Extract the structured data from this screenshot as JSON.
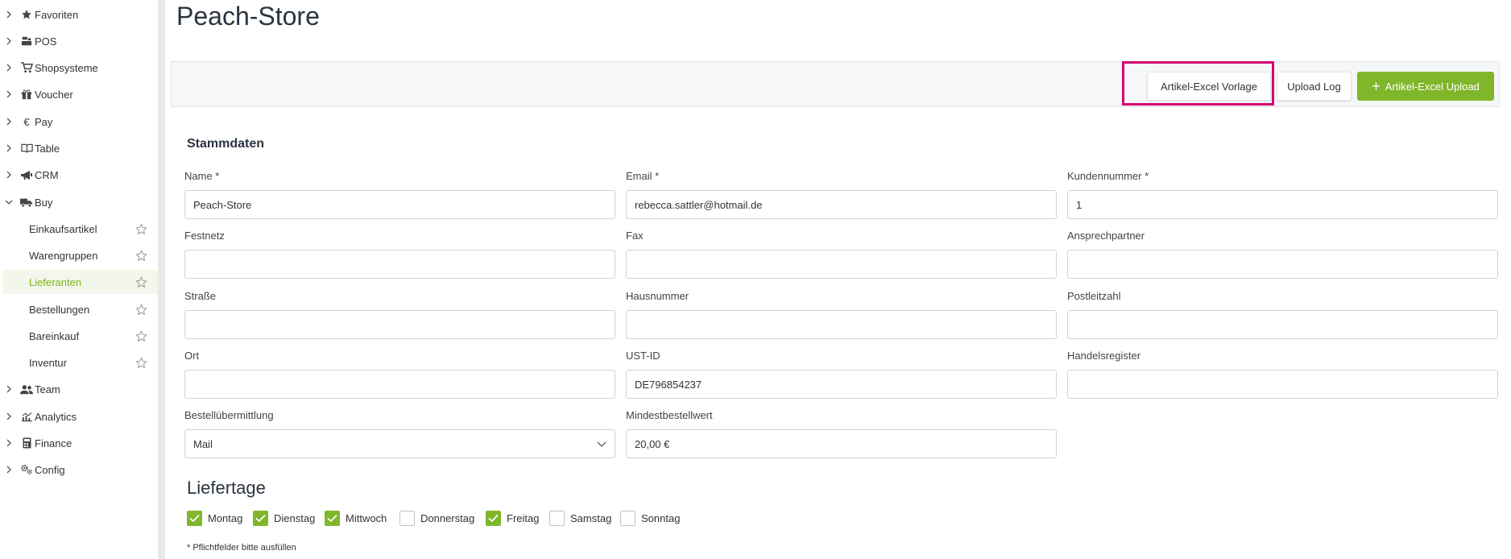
{
  "sidebar": {
    "items": [
      {
        "label": "Favoriten",
        "icon": "star-icon"
      },
      {
        "label": "POS",
        "icon": "register-icon"
      },
      {
        "label": "Shopsysteme",
        "icon": "cart-icon"
      },
      {
        "label": "Voucher",
        "icon": "gift-icon"
      },
      {
        "label": "Pay",
        "icon": "euro-icon"
      },
      {
        "label": "Table",
        "icon": "book-icon"
      },
      {
        "label": "CRM",
        "icon": "megaphone-icon"
      },
      {
        "label": "Buy",
        "icon": "truck-icon"
      }
    ],
    "buy_subitems": [
      {
        "label": "Einkaufsartikel"
      },
      {
        "label": "Warengruppen"
      },
      {
        "label": "Lieferanten"
      },
      {
        "label": "Bestellungen"
      },
      {
        "label": "Bareinkauf"
      },
      {
        "label": "Inventur"
      }
    ],
    "items_after": [
      {
        "label": "Team",
        "icon": "users-icon"
      },
      {
        "label": "Analytics",
        "icon": "chart-icon"
      },
      {
        "label": "Finance",
        "icon": "calculator-icon"
      },
      {
        "label": "Config",
        "icon": "gears-icon"
      }
    ],
    "euro_glyph": "€"
  },
  "page": {
    "title": "Peach-Store"
  },
  "toolbar": {
    "excel_template_label": "Artikel-Excel Vorlage",
    "upload_log_label": "Upload Log",
    "excel_upload_label": "Artikel-Excel Upload",
    "plus_glyph": "+"
  },
  "form": {
    "section_title": "Stammdaten",
    "fields": {
      "name": {
        "label": "Name *",
        "value": "Peach-Store"
      },
      "email": {
        "label": "Email *",
        "value": "rebecca.sattler@hotmail.de"
      },
      "kundennummer": {
        "label": "Kundennummer *",
        "value": "1"
      },
      "festnetz": {
        "label": "Festnetz",
        "value": ""
      },
      "fax": {
        "label": "Fax",
        "value": ""
      },
      "ansprechpartner": {
        "label": "Ansprechpartner",
        "value": ""
      },
      "strasse": {
        "label": "Straße",
        "value": ""
      },
      "hausnummer": {
        "label": "Hausnummer",
        "value": ""
      },
      "postleitzahl": {
        "label": "Postleitzahl",
        "value": ""
      },
      "ort": {
        "label": "Ort",
        "value": ""
      },
      "ust_id": {
        "label": "UST-ID",
        "value": "DE796854237"
      },
      "handelsregister": {
        "label": "Handelsregister",
        "value": ""
      },
      "bestelluebermittlung": {
        "label": "Bestellübermittlung",
        "value": "Mail"
      },
      "mindestbestellwert": {
        "label": "Mindestbestellwert",
        "value": "20,00 €"
      }
    }
  },
  "liefertage": {
    "title": "Liefertage",
    "days": [
      {
        "label": "Montag",
        "checked": true
      },
      {
        "label": "Dienstag",
        "checked": true
      },
      {
        "label": "Mittwoch",
        "checked": true
      },
      {
        "label": "Donnerstag",
        "checked": false
      },
      {
        "label": "Freitag",
        "checked": true
      },
      {
        "label": "Samstag",
        "checked": false
      },
      {
        "label": "Sonntag",
        "checked": false
      }
    ]
  },
  "footnote": "* Pflichtfelder bitte ausfüllen",
  "colors": {
    "accent_green": "#80b62a",
    "highlight_magenta": "#d4006f",
    "active_text": "#7fb51f"
  }
}
